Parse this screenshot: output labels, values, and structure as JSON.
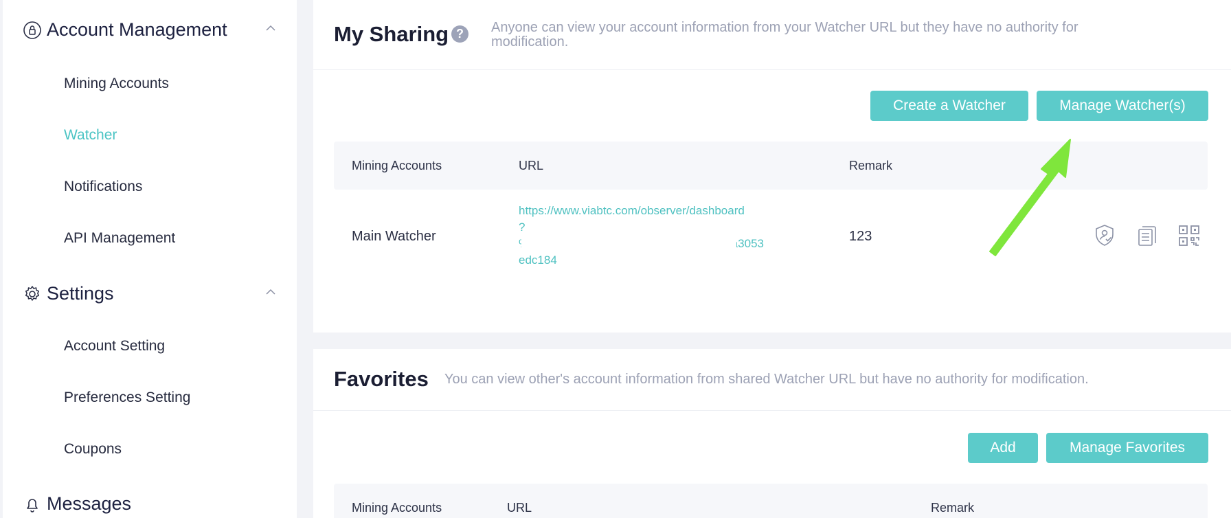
{
  "sidebar": {
    "groups": [
      {
        "label": "Account Management",
        "icon": "lock-circle-icon"
      },
      {
        "label": "Settings",
        "icon": "gear-icon"
      },
      {
        "label": "Messages",
        "icon": "bell-icon"
      }
    ],
    "items": [
      {
        "label": "Mining Accounts"
      },
      {
        "label": "Watcher",
        "active": true
      },
      {
        "label": "Notifications"
      },
      {
        "label": "API Management"
      },
      {
        "label": "Account Setting"
      },
      {
        "label": "Preferences Setting"
      },
      {
        "label": "Coupons"
      }
    ]
  },
  "sharing": {
    "title": "My Sharing",
    "help_glyph": "?",
    "description_line1": "Anyone can view your account information from your Watcher URL but they have no authority for",
    "description_line2": "modification.",
    "create_label": "Create a Watcher",
    "manage_label": "Manage Watcher(s)",
    "columns": [
      "Mining Accounts",
      "URL",
      "Remark"
    ],
    "rows": [
      {
        "account": "Main Watcher",
        "url_lines": [
          "https://www.viabtc.com/observer/dashboard",
          "?",
          "%",
          "a3053",
          "edc184"
        ],
        "remark": "123",
        "actions": [
          "shield-user-icon",
          "copy-document-icon",
          "qr-code-icon"
        ]
      }
    ]
  },
  "favorites": {
    "title": "Favorites",
    "description": "You can view other's account information from shared Watcher URL but have no authority for modification.",
    "add_label": "Add",
    "manage_label": "Manage Favorites",
    "columns": [
      "Mining Accounts",
      "URL",
      "Remark"
    ]
  },
  "colors": {
    "accent": "#5ccbca",
    "active_nav": "#4bc4c4",
    "annotation_arrow": "#7fe63c"
  }
}
